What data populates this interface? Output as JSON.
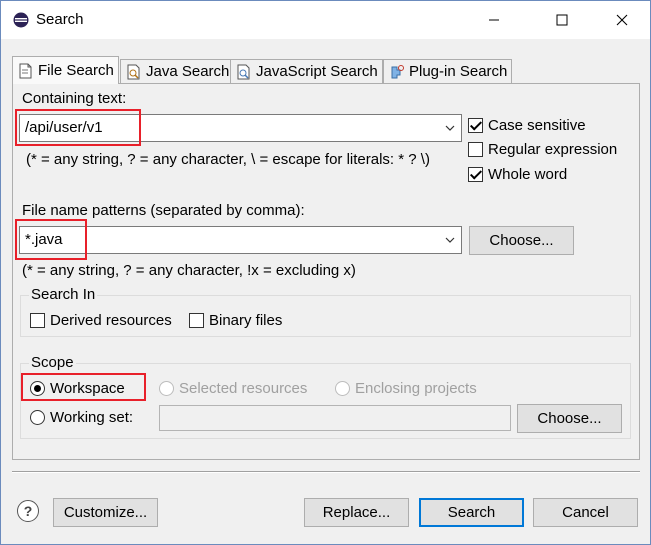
{
  "window": {
    "title": "Search"
  },
  "tabs": [
    {
      "label": "File Search",
      "icon": "file-search-icon",
      "active": true
    },
    {
      "label": "Java Search",
      "icon": "java-search-icon",
      "active": false
    },
    {
      "label": "JavaScript Search",
      "icon": "javascript-search-icon",
      "active": false
    },
    {
      "label": "Plug-in Search",
      "icon": "plugin-search-icon",
      "active": false
    }
  ],
  "containing": {
    "label": "Containing text:",
    "value": "/api/user/v1",
    "hint": "(* = any string, ? = any character, \\ = escape for literals: * ? \\)",
    "options": [
      {
        "label": "Case sensitive",
        "checked": true
      },
      {
        "label": "Regular expression",
        "checked": false
      },
      {
        "label": "Whole word",
        "checked": true
      }
    ]
  },
  "file_patterns": {
    "label": "File name patterns (separated by comma):",
    "value": "*.java",
    "choose_label": "Choose...",
    "hint": "(* = any string, ? = any character, !x = excluding x)"
  },
  "search_in": {
    "title": "Search In",
    "options": [
      {
        "label": "Derived resources",
        "checked": false
      },
      {
        "label": "Binary files",
        "checked": false
      }
    ]
  },
  "scope": {
    "title": "Scope",
    "workspace_label": "Workspace",
    "selected_label": "Selected resources",
    "enclosing_label": "Enclosing projects",
    "working_set_label": "Working set:",
    "working_set_value": "",
    "choose_label": "Choose...",
    "selected": "Workspace"
  },
  "footer": {
    "customize_label": "Customize...",
    "replace_label": "Replace...",
    "search_label": "Search",
    "cancel_label": "Cancel"
  },
  "colors": {
    "highlight": "#e8202a",
    "accent": "#0078d7"
  }
}
